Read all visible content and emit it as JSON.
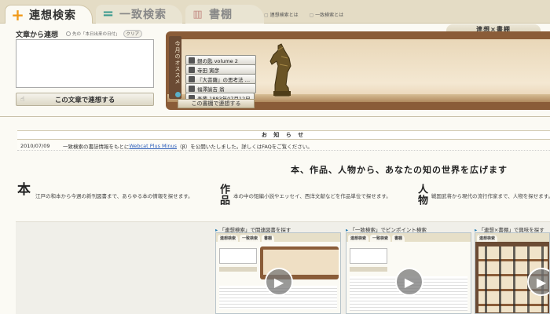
{
  "tabs": [
    {
      "label": "連想検索",
      "active": true
    },
    {
      "label": "一致検索",
      "active": false
    },
    {
      "label": "書棚",
      "active": false
    }
  ],
  "toplinks": [
    "連想検索とは",
    "一致検索とは"
  ],
  "rensou": {
    "title": "文章から連想",
    "checkbox_label": "先の「本日出来の日付」",
    "clear_label": "クリア",
    "button_label": "この文章で連想する"
  },
  "shelf": {
    "label": "連想×書棚",
    "osusume": "今月のオススメ",
    "books": [
      "銀の匙 volume 2",
      "寺田 寅彦",
      "『大菩薩』の思考法 …",
      "福澤諭吉 翁",
      "吾輩 1883年07月12日"
    ],
    "button_label": "この書棚で連想する"
  },
  "notices": {
    "heading": "お 知 ら せ",
    "items": [
      {
        "date": "2010/07/09",
        "text_before": "一致検索の書誌情報をもとに",
        "link": "Webcat Plus Minus",
        "text_after": "（β）を公開いたしました。詳しくはFAQをご覧ください。"
      }
    ]
  },
  "tagline": "本、作品、人物から、あなたの知の世界を広げます",
  "features": [
    {
      "title": "本",
      "desc": "江戸の和本から今週の新刊図書まで、あらゆる本の情報を探せます。"
    },
    {
      "title": "作品",
      "desc": "本の中の短編小説やエッセイ、西洋文献などを作品単位で探せます。"
    },
    {
      "title": "人物",
      "desc": "戦国武将から現代の流行作家まで、人物を探せます。"
    }
  ],
  "videos": [
    {
      "caption": "「連想検索」で関連図書を探す"
    },
    {
      "caption": "「一致検索」でピンポイント検索"
    },
    {
      "caption": "「連想×書棚」で興味を探す"
    }
  ],
  "icons": {
    "rensou_tab": "plus-icon",
    "itchi_tab": "equals-icon",
    "shodana_tab": "bookshelf-icon",
    "play": "play-icon"
  },
  "colors": {
    "accent_orange": "#f09a1a",
    "accent_teal": "#3a9a8e",
    "shelf_wood": "#8a5c38",
    "link": "#2a5cb8"
  }
}
